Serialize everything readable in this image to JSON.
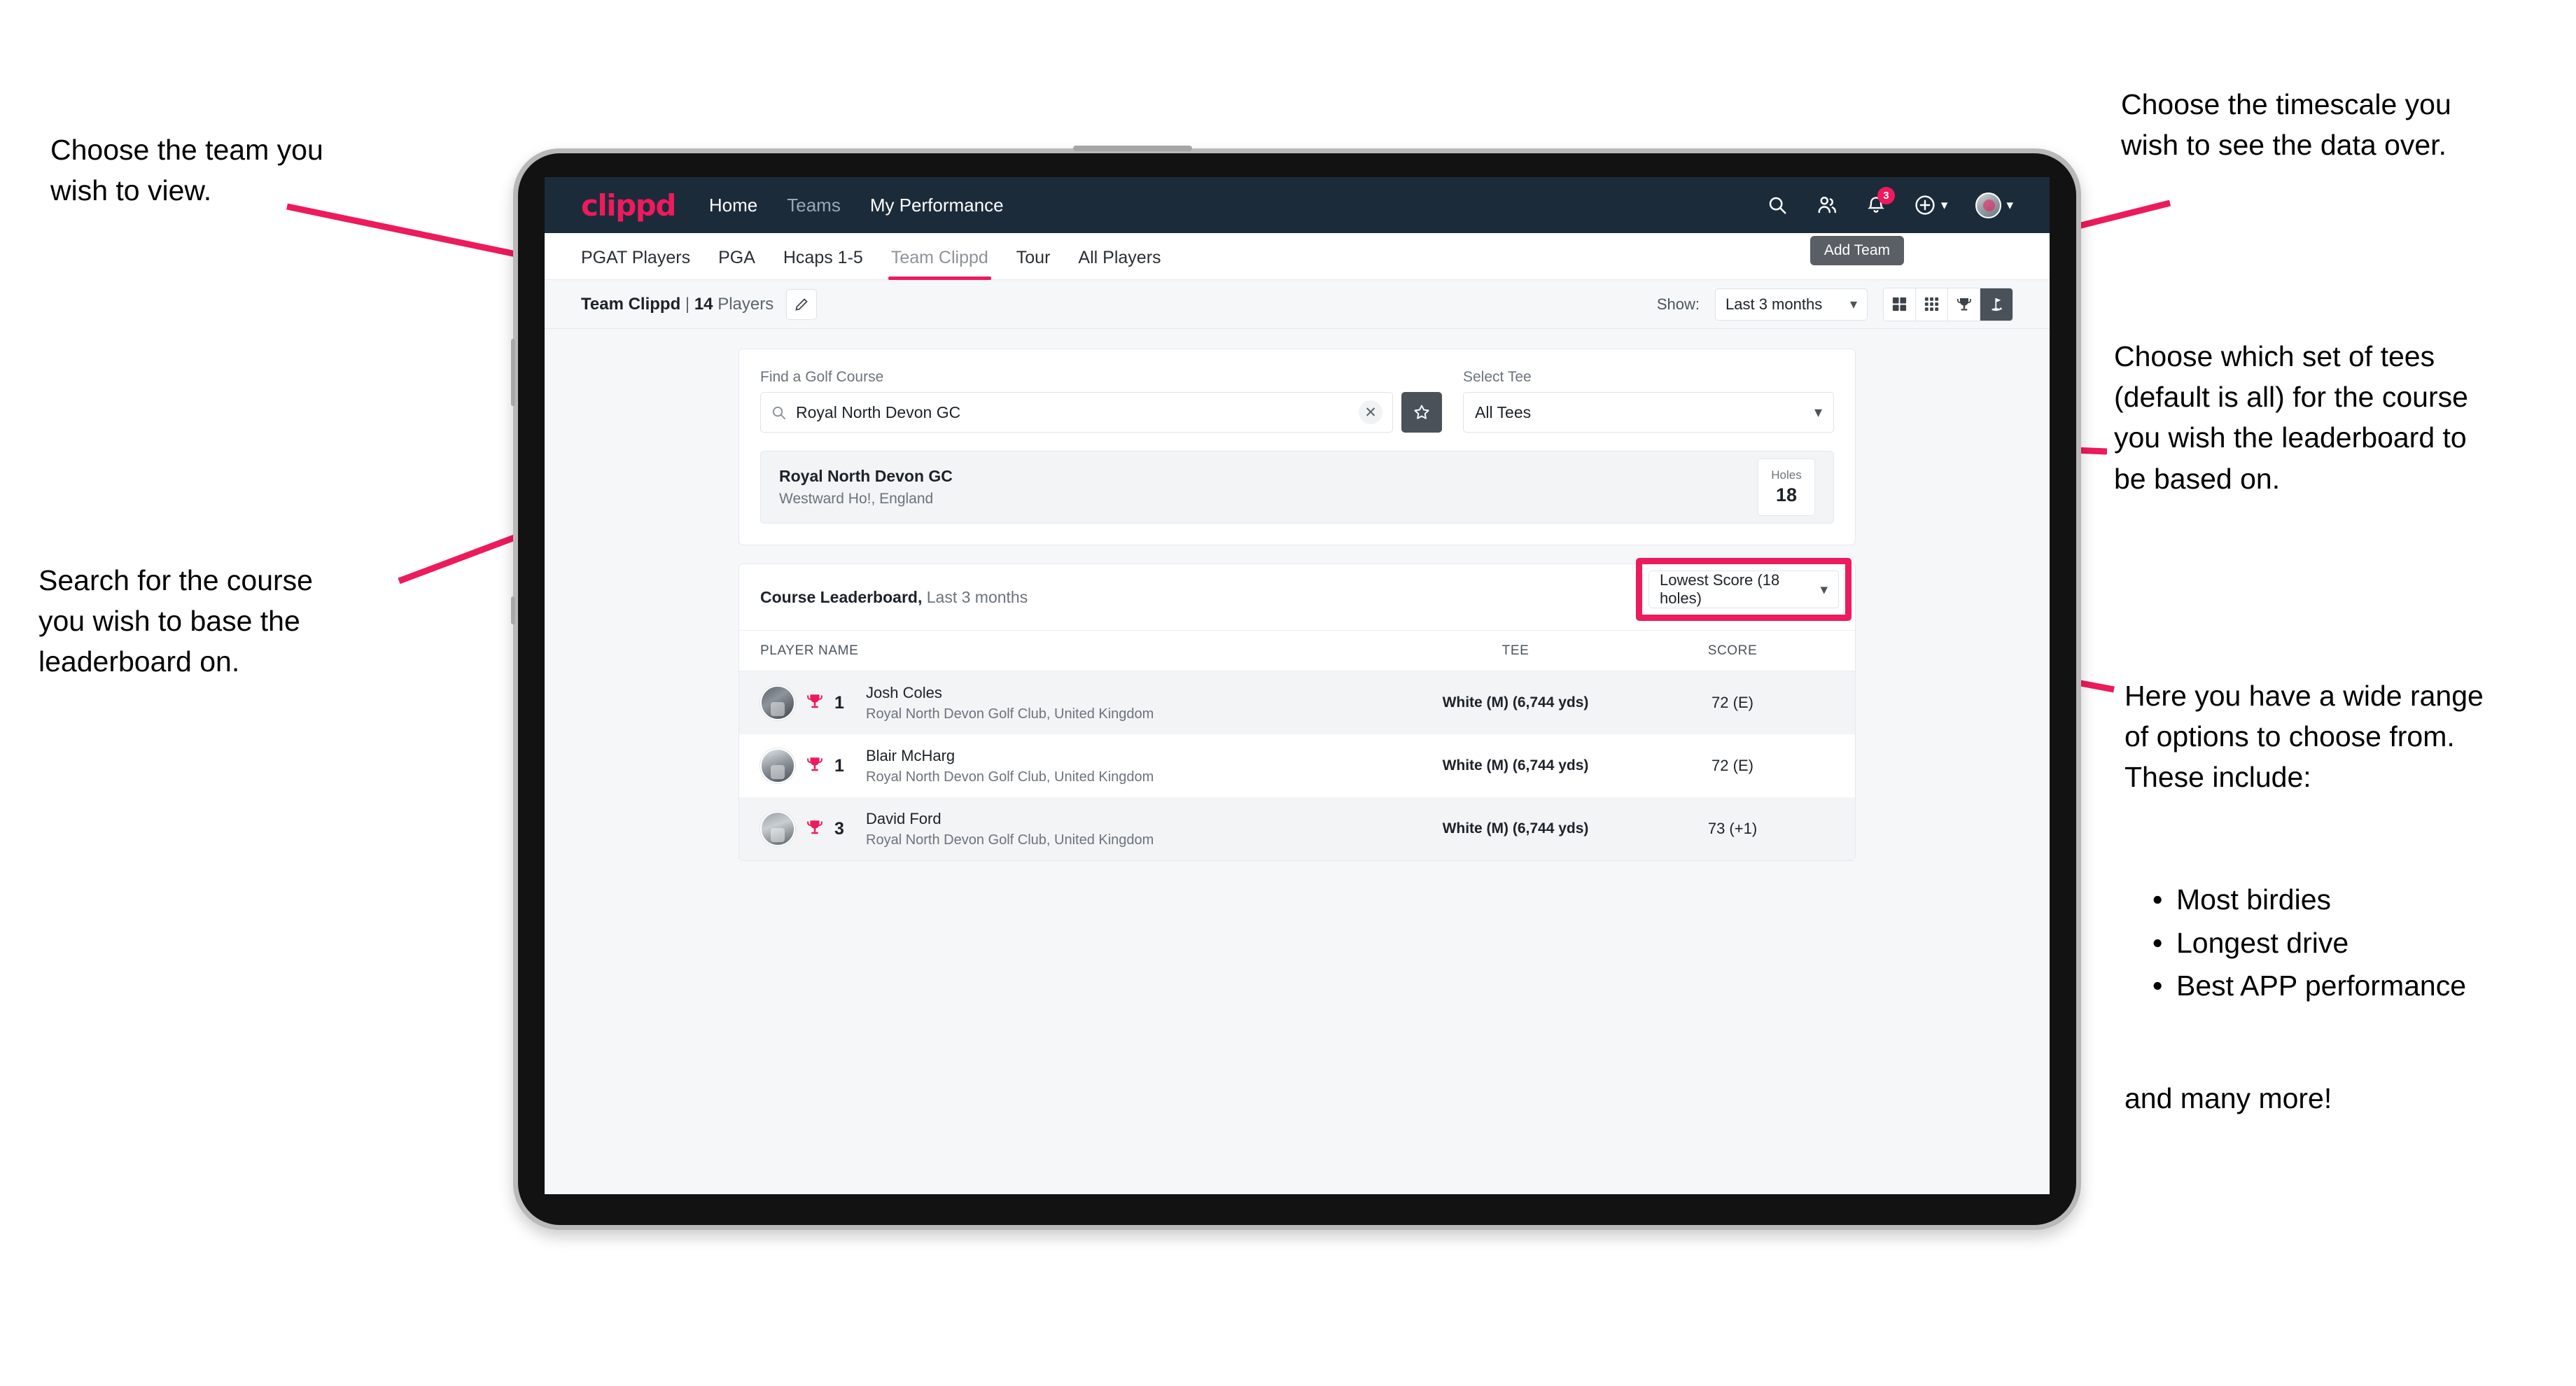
{
  "annotations": {
    "top_left": "Choose the team you\nwish to view.",
    "mid_left": "Search for the course\nyou wish to base the\nleaderboard on.",
    "top_right": "Choose the timescale you\nwish to see the data over.",
    "mid_right": "Choose which set of tees\n(default is all) for the course\nyou wish the leaderboard to\nbe based on.",
    "bottom_right_intro": "Here you have a wide range\nof options to choose from.\nThese include:",
    "bottom_right_bullets": [
      "Most birdies",
      "Longest drive",
      "Best APP performance"
    ],
    "bottom_right_outro": "and many more!"
  },
  "navbar": {
    "logo": "clippd",
    "links": [
      {
        "label": "Home",
        "active": true
      },
      {
        "label": "Teams",
        "active": false
      },
      {
        "label": "My Performance",
        "active": true
      }
    ],
    "icons": [
      "search-icon",
      "people-icon",
      "bell-icon",
      "plus-circle-icon",
      "avatar-icon"
    ],
    "notification_count": "3",
    "tooltip": "Add Team"
  },
  "tabs": [
    {
      "label": "PGAT Players",
      "active": false
    },
    {
      "label": "PGA",
      "active": false
    },
    {
      "label": "Hcaps 1-5",
      "active": false
    },
    {
      "label": "Team Clippd",
      "active": true
    },
    {
      "label": "Tour",
      "active": false
    },
    {
      "label": "All Players",
      "active": false
    }
  ],
  "subbar": {
    "team_name": "Team Clippd",
    "separator": "|",
    "player_count": "14",
    "players_word": "Players",
    "edit_icon": "pencil-icon",
    "show_label": "Show:",
    "period_value": "Last 3 months",
    "view_toggles": [
      {
        "icon": "grid-large-icon",
        "active": false
      },
      {
        "icon": "grid-small-icon",
        "active": false
      },
      {
        "icon": "trophy-icon",
        "active": false
      },
      {
        "icon": "golf-flag-icon",
        "active": true
      }
    ]
  },
  "search_panel": {
    "course_label": "Find a Golf Course",
    "course_value": "Royal North Devon GC",
    "course_placeholder": "Find a Golf Course",
    "clear_icon": "close-icon",
    "star_icon": "star-icon",
    "tee_label": "Select Tee",
    "tee_value": "All Tees"
  },
  "course_result": {
    "name": "Royal North Devon GC",
    "location": "Westward Ho!, England",
    "holes_label": "Holes",
    "holes_value": "18"
  },
  "leaderboard": {
    "title": "Course Leaderboard,",
    "subtitle": "Last 3 months",
    "metric_value": "Lowest Score (18 holes)",
    "columns": [
      "PLAYER NAME",
      "TEE",
      "SCORE"
    ],
    "rows": [
      {
        "rank": "1",
        "name": "Josh Coles",
        "club": "Royal North Devon Golf Club, United Kingdom",
        "tee": "White (M) (6,744 yds)",
        "score": "72 (E)"
      },
      {
        "rank": "1",
        "name": "Blair McHarg",
        "club": "Royal North Devon Golf Club, United Kingdom",
        "tee": "White (M) (6,744 yds)",
        "score": "72 (E)"
      },
      {
        "rank": "3",
        "name": "David Ford",
        "club": "Royal North Devon Golf Club, United Kingdom",
        "tee": "White (M) (6,744 yds)",
        "score": "73 (+1)"
      }
    ]
  },
  "colors": {
    "accent_pink": "#ed1a5c",
    "navbar_dark": "#1c2b3a",
    "toggle_active": "#4a5159",
    "page_bg": "#f5f7f9"
  }
}
